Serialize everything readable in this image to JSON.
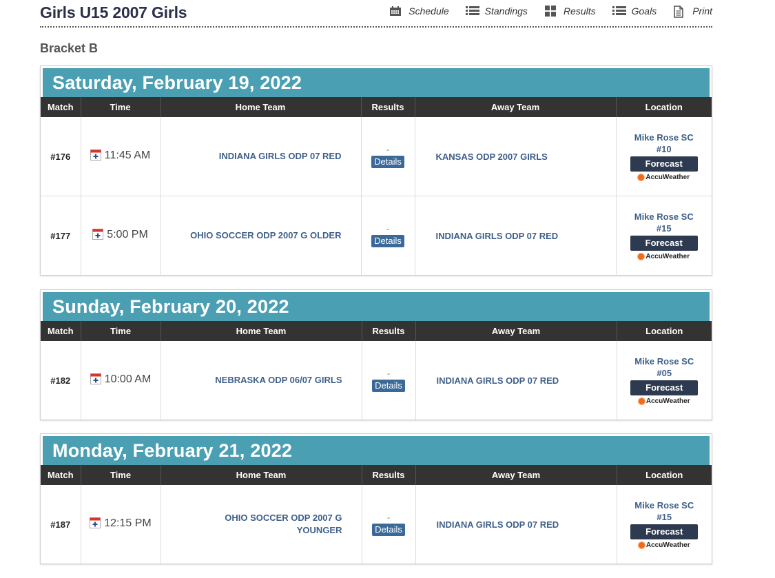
{
  "header": {
    "title": "Girls U15 2007 Girls",
    "nav": [
      {
        "label": "Schedule",
        "icon": "calendar-icon"
      },
      {
        "label": "Standings",
        "icon": "list-icon"
      },
      {
        "label": "Results",
        "icon": "grid-icon"
      },
      {
        "label": "Goals",
        "icon": "list-icon"
      },
      {
        "label": "Print",
        "icon": "document-icon"
      }
    ]
  },
  "bracket": "Bracket B",
  "columns": [
    "Match",
    "Time",
    "Home Team",
    "Results",
    "Away Team",
    "Location"
  ],
  "days": [
    {
      "date": "Saturday, February 19, 2022",
      "games": [
        {
          "match": "#176",
          "time": "11:45 AM",
          "home": "INDIANA GIRLS ODP 07 RED",
          "result": "-",
          "away": "KANSAS ODP 2007 GIRLS",
          "location_name": "Mike Rose SC",
          "field": "#10"
        },
        {
          "match": "#177",
          "time": "5:00 PM",
          "home": "OHIO SOCCER ODP 2007 G OLDER",
          "result": "-",
          "away": "INDIANA GIRLS ODP 07 RED",
          "location_name": "Mike Rose SC",
          "field": "#15"
        }
      ]
    },
    {
      "date": "Sunday, February 20, 2022",
      "games": [
        {
          "match": "#182",
          "time": "10:00 AM",
          "home": "NEBRASKA ODP 06/07 GIRLS",
          "result": "-",
          "away": "INDIANA GIRLS ODP 07 RED",
          "location_name": "Mike Rose SC",
          "field": "#05"
        }
      ]
    },
    {
      "date": "Monday, February 21, 2022",
      "games": [
        {
          "match": "#187",
          "time": "12:15 PM",
          "home_line1": "OHIO SOCCER ODP 2007 G",
          "home_line2": "YOUNGER",
          "result": "-",
          "away": "INDIANA GIRLS ODP 07 RED",
          "location_name": "Mike Rose SC",
          "field": "#15"
        }
      ]
    }
  ],
  "labels": {
    "details": "Details",
    "forecast": "Forecast",
    "accuweather": "AccuWeather"
  },
  "colors": {
    "day_header": "#4b9fb2",
    "table_header": "#333333",
    "link": "#3f5f8a",
    "details_button": "#3b6a99",
    "forecast_button": "#2e3a4f",
    "accuweather_sun": "#f26a1b"
  }
}
